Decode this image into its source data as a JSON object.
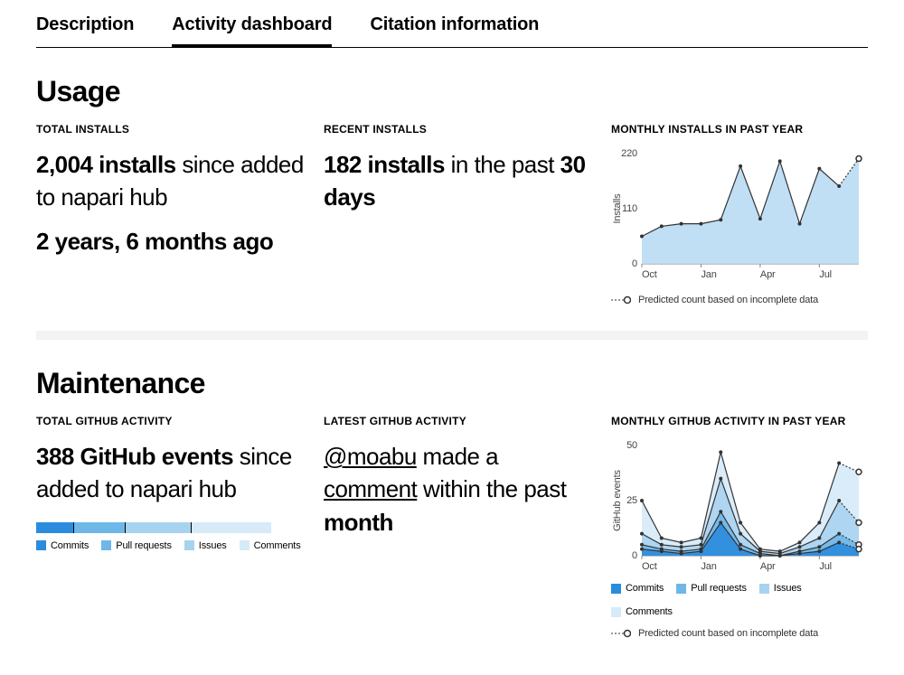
{
  "tabs": {
    "t0": "Description",
    "t1": "Activity dashboard",
    "t2": "Citation information"
  },
  "usage": {
    "heading": "Usage",
    "total_label": "TOTAL INSTALLS",
    "total_count": "2,004 installs",
    "total_suffix": " since added to napari hub",
    "total_age": "2 years, 6 months ago",
    "recent_label": "RECENT INSTALLS",
    "recent_count": "182 installs",
    "recent_mid": " in the past ",
    "recent_period": "30 days",
    "chart_label": "MONTHLY INSTALLS IN PAST YEAR",
    "predicted": "Predicted count based on incomplete data"
  },
  "maint": {
    "heading": "Maintenance",
    "total_label": "TOTAL GITHUB ACTIVITY",
    "total_count": "388 GitHub events",
    "total_suffix": " since added to napari hub",
    "latest_label": "LATEST GITHUB ACTIVITY",
    "latest_user": "@moabu",
    "latest_mid": " made a ",
    "latest_action": "comment",
    "latest_mid2": " within the past ",
    "latest_period": "month",
    "chart_label": "MONTHLY GITHUB ACTIVITY IN PAST YEAR",
    "predicted": "Predicted count based on incomplete data",
    "leg_commits": "Commits",
    "leg_prs": "Pull requests",
    "leg_issues": "Issues",
    "leg_comments": "Comments"
  },
  "colors": {
    "c1": "#2b8cde",
    "c2": "#6fb7e8",
    "c3": "#a8d3f0",
    "c4": "#d6eaf8",
    "fill": "#b9dcf4",
    "line": "#333"
  },
  "chart_data": [
    {
      "type": "area",
      "title": "Monthly installs in past year",
      "ylabel": "Installs",
      "ylim": [
        0,
        220
      ],
      "categories": [
        "Oct",
        "Nov",
        "Dec",
        "Jan",
        "Feb",
        "Mar",
        "Apr",
        "May",
        "Jun",
        "Jul",
        "Aug",
        "Sep"
      ],
      "values": [
        55,
        75,
        80,
        80,
        88,
        195,
        90,
        205,
        80,
        190,
        155,
        210
      ],
      "predicted_last": true,
      "y_ticks": [
        0,
        110,
        220
      ],
      "x_tick_labels": [
        "Oct",
        "Jan",
        "Apr",
        "Jul"
      ]
    },
    {
      "type": "area",
      "title": "Monthly GitHub activity in past year",
      "ylabel": "GitHub events",
      "ylim": [
        0,
        50
      ],
      "categories": [
        "Oct",
        "Nov",
        "Dec",
        "Jan",
        "Feb",
        "Mar",
        "Apr",
        "May",
        "Jun",
        "Jul",
        "Aug",
        "Sep"
      ],
      "series": [
        {
          "name": "Commits",
          "values": [
            3,
            2,
            1,
            2,
            15,
            3,
            0,
            0,
            1,
            2,
            6,
            3
          ]
        },
        {
          "name": "Pull requests",
          "values": [
            5,
            3,
            2,
            3,
            20,
            5,
            1,
            0,
            2,
            4,
            10,
            5
          ]
        },
        {
          "name": "Issues",
          "values": [
            10,
            5,
            4,
            5,
            35,
            10,
            2,
            1,
            4,
            8,
            25,
            15
          ]
        },
        {
          "name": "Comments",
          "values": [
            25,
            8,
            6,
            8,
            47,
            15,
            3,
            2,
            6,
            15,
            42,
            38
          ]
        }
      ],
      "predicted_last": true,
      "y_ticks": [
        0,
        25,
        50
      ],
      "x_tick_labels": [
        "Oct",
        "Jan",
        "Apr",
        "Jul"
      ],
      "total_bar_proportions": {
        "Commits": 0.16,
        "Pull requests": 0.22,
        "Issues": 0.28,
        "Comments": 0.34
      }
    }
  ]
}
